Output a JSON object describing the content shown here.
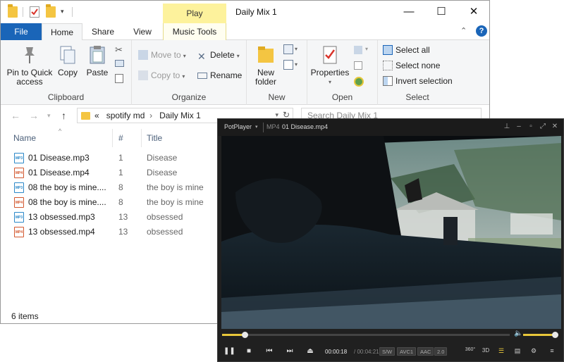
{
  "explorer": {
    "window_title": "Daily Mix 1",
    "context_tab": "Play",
    "tabs": {
      "file": "File",
      "home": "Home",
      "share": "Share",
      "view": "View",
      "music_tools": "Music Tools"
    },
    "help_label": "?",
    "ribbon": {
      "clipboard": {
        "label": "Clipboard",
        "pin": "Pin to Quick access",
        "copy": "Copy",
        "paste": "Paste"
      },
      "organize": {
        "label": "Organize",
        "move_to": "Move to",
        "copy_to": "Copy to",
        "delete": "Delete",
        "rename": "Rename"
      },
      "new": {
        "label": "New",
        "new_folder": "New folder"
      },
      "open": {
        "label": "Open",
        "properties": "Properties"
      },
      "select": {
        "label": "Select",
        "select_all": "Select all",
        "select_none": "Select none",
        "invert": "Invert selection"
      }
    },
    "address": {
      "prefix": "«",
      "path": [
        "spotify md",
        "Daily Mix 1"
      ]
    },
    "search_placeholder": "Search Daily Mix 1",
    "columns": {
      "name": "Name",
      "number": "#",
      "title": "Title"
    },
    "files": [
      {
        "name": "01 Disease.mp3",
        "num": "1",
        "title": "Disease",
        "type": "MP3",
        "color": "#2b88c8"
      },
      {
        "name": "01 Disease.mp4",
        "num": "1",
        "title": "Disease",
        "type": "MP4",
        "color": "#d2572e"
      },
      {
        "name": "08 the boy is mine....",
        "num": "8",
        "title": "the boy is mine",
        "type": "MP3",
        "color": "#2b88c8"
      },
      {
        "name": "08 the boy is mine....",
        "num": "8",
        "title": "the boy is mine",
        "type": "MP4",
        "color": "#d2572e"
      },
      {
        "name": "13 obsessed.mp3",
        "num": "13",
        "title": "obsessed",
        "type": "MP3",
        "color": "#2b88c8"
      },
      {
        "name": "13 obsessed.mp4",
        "num": "13",
        "title": "obsessed",
        "type": "MP4",
        "color": "#d2572e"
      }
    ],
    "status": "6 items"
  },
  "player": {
    "brand": "PotPlayer",
    "format": "MP4",
    "filename": "01 Disease.mp4",
    "time_current": "00:00:18",
    "time_total": "/ 00:04:21",
    "badges": [
      "S/W",
      "AVC1",
      "AAC",
      "2.0"
    ],
    "extra_icons": [
      "360°",
      "3D"
    ],
    "seek_progress": 0.078,
    "volume_level": 0.9,
    "accent_color": "#e8c73a"
  }
}
